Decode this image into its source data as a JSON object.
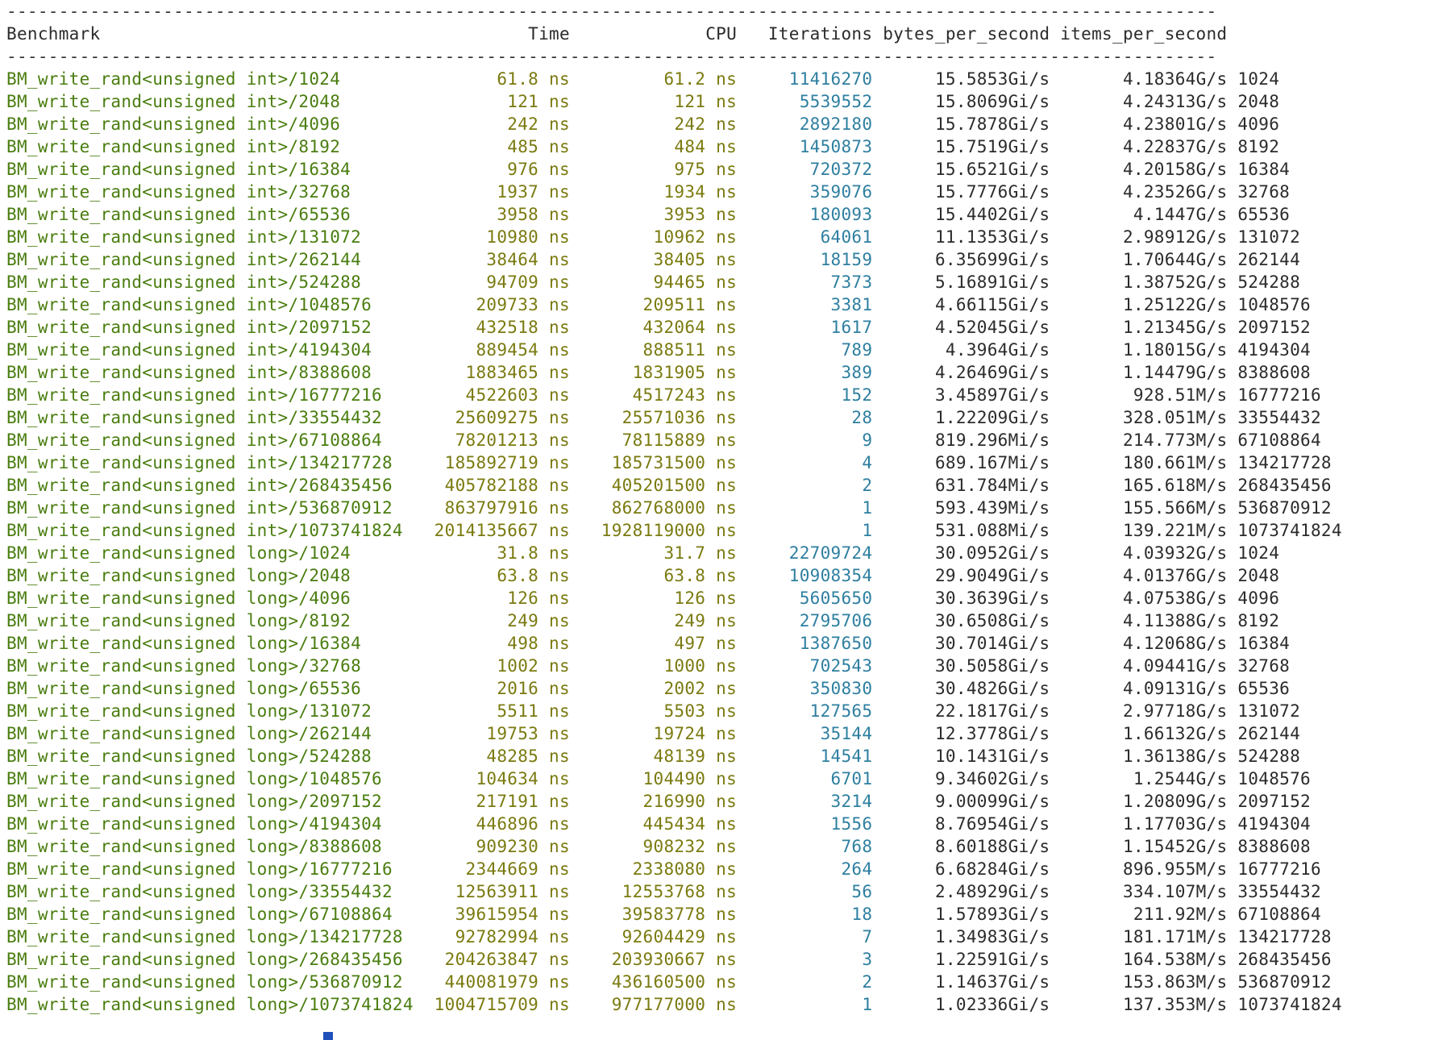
{
  "header": {
    "rule": "--------------------------------------------------------------------------------------------------------------------",
    "columns": [
      "Benchmark",
      "Time",
      "CPU",
      "Iterations",
      "bytes_per_second",
      "items_per_second"
    ]
  },
  "unit": "ns",
  "rows": [
    [
      "BM_write_rand<unsigned int>/1024",
      "61.8",
      "61.2",
      "11416270",
      "15.5853Gi/s",
      "4.18364G/s",
      "1024"
    ],
    [
      "BM_write_rand<unsigned int>/2048",
      "121",
      "121",
      "5539552",
      "15.8069Gi/s",
      "4.24313G/s",
      "2048"
    ],
    [
      "BM_write_rand<unsigned int>/4096",
      "242",
      "242",
      "2892180",
      "15.7878Gi/s",
      "4.23801G/s",
      "4096"
    ],
    [
      "BM_write_rand<unsigned int>/8192",
      "485",
      "484",
      "1450873",
      "15.7519Gi/s",
      "4.22837G/s",
      "8192"
    ],
    [
      "BM_write_rand<unsigned int>/16384",
      "976",
      "975",
      "720372",
      "15.6521Gi/s",
      "4.20158G/s",
      "16384"
    ],
    [
      "BM_write_rand<unsigned int>/32768",
      "1937",
      "1934",
      "359076",
      "15.7776Gi/s",
      "4.23526G/s",
      "32768"
    ],
    [
      "BM_write_rand<unsigned int>/65536",
      "3958",
      "3953",
      "180093",
      "15.4402Gi/s",
      "4.1447G/s",
      "65536"
    ],
    [
      "BM_write_rand<unsigned int>/131072",
      "10980",
      "10962",
      "64061",
      "11.1353Gi/s",
      "2.98912G/s",
      "131072"
    ],
    [
      "BM_write_rand<unsigned int>/262144",
      "38464",
      "38405",
      "18159",
      "6.35699Gi/s",
      "1.70644G/s",
      "262144"
    ],
    [
      "BM_write_rand<unsigned int>/524288",
      "94709",
      "94465",
      "7373",
      "5.16891Gi/s",
      "1.38752G/s",
      "524288"
    ],
    [
      "BM_write_rand<unsigned int>/1048576",
      "209733",
      "209511",
      "3381",
      "4.66115Gi/s",
      "1.25122G/s",
      "1048576"
    ],
    [
      "BM_write_rand<unsigned int>/2097152",
      "432518",
      "432064",
      "1617",
      "4.52045Gi/s",
      "1.21345G/s",
      "2097152"
    ],
    [
      "BM_write_rand<unsigned int>/4194304",
      "889454",
      "888511",
      "789",
      "4.3964Gi/s",
      "1.18015G/s",
      "4194304"
    ],
    [
      "BM_write_rand<unsigned int>/8388608",
      "1883465",
      "1831905",
      "389",
      "4.26469Gi/s",
      "1.14479G/s",
      "8388608"
    ],
    [
      "BM_write_rand<unsigned int>/16777216",
      "4522603",
      "4517243",
      "152",
      "3.45897Gi/s",
      "928.51M/s",
      "16777216"
    ],
    [
      "BM_write_rand<unsigned int>/33554432",
      "25609275",
      "25571036",
      "28",
      "1.22209Gi/s",
      "328.051M/s",
      "33554432"
    ],
    [
      "BM_write_rand<unsigned int>/67108864",
      "78201213",
      "78115889",
      "9",
      "819.296Mi/s",
      "214.773M/s",
      "67108864"
    ],
    [
      "BM_write_rand<unsigned int>/134217728",
      "185892719",
      "185731500",
      "4",
      "689.167Mi/s",
      "180.661M/s",
      "134217728"
    ],
    [
      "BM_write_rand<unsigned int>/268435456",
      "405782188",
      "405201500",
      "2",
      "631.784Mi/s",
      "165.618M/s",
      "268435456"
    ],
    [
      "BM_write_rand<unsigned int>/536870912",
      "863797916",
      "862768000",
      "1",
      "593.439Mi/s",
      "155.566M/s",
      "536870912"
    ],
    [
      "BM_write_rand<unsigned int>/1073741824",
      "2014135667",
      "1928119000",
      "1",
      "531.088Mi/s",
      "139.221M/s",
      "1073741824"
    ],
    [
      "BM_write_rand<unsigned long>/1024",
      "31.8",
      "31.7",
      "22709724",
      "30.0952Gi/s",
      "4.03932G/s",
      "1024"
    ],
    [
      "BM_write_rand<unsigned long>/2048",
      "63.8",
      "63.8",
      "10908354",
      "29.9049Gi/s",
      "4.01376G/s",
      "2048"
    ],
    [
      "BM_write_rand<unsigned long>/4096",
      "126",
      "126",
      "5605650",
      "30.3639Gi/s",
      "4.07538G/s",
      "4096"
    ],
    [
      "BM_write_rand<unsigned long>/8192",
      "249",
      "249",
      "2795706",
      "30.6508Gi/s",
      "4.11388G/s",
      "8192"
    ],
    [
      "BM_write_rand<unsigned long>/16384",
      "498",
      "497",
      "1387650",
      "30.7014Gi/s",
      "4.12068G/s",
      "16384"
    ],
    [
      "BM_write_rand<unsigned long>/32768",
      "1002",
      "1000",
      "702543",
      "30.5058Gi/s",
      "4.09441G/s",
      "32768"
    ],
    [
      "BM_write_rand<unsigned long>/65536",
      "2016",
      "2002",
      "350830",
      "30.4826Gi/s",
      "4.09131G/s",
      "65536"
    ],
    [
      "BM_write_rand<unsigned long>/131072",
      "5511",
      "5503",
      "127565",
      "22.1817Gi/s",
      "2.97718G/s",
      "131072"
    ],
    [
      "BM_write_rand<unsigned long>/262144",
      "19753",
      "19724",
      "35144",
      "12.3778Gi/s",
      "1.66132G/s",
      "262144"
    ],
    [
      "BM_write_rand<unsigned long>/524288",
      "48285",
      "48139",
      "14541",
      "10.1431Gi/s",
      "1.36138G/s",
      "524288"
    ],
    [
      "BM_write_rand<unsigned long>/1048576",
      "104634",
      "104490",
      "6701",
      "9.34602Gi/s",
      "1.2544G/s",
      "1048576"
    ],
    [
      "BM_write_rand<unsigned long>/2097152",
      "217191",
      "216990",
      "3214",
      "9.00099Gi/s",
      "1.20809G/s",
      "2097152"
    ],
    [
      "BM_write_rand<unsigned long>/4194304",
      "446896",
      "445434",
      "1556",
      "8.76954Gi/s",
      "1.17703G/s",
      "4194304"
    ],
    [
      "BM_write_rand<unsigned long>/8388608",
      "909230",
      "908232",
      "768",
      "8.60188Gi/s",
      "1.15452G/s",
      "8388608"
    ],
    [
      "BM_write_rand<unsigned long>/16777216",
      "2344669",
      "2338080",
      "264",
      "6.68284Gi/s",
      "896.955M/s",
      "16777216"
    ],
    [
      "BM_write_rand<unsigned long>/33554432",
      "12563911",
      "12553768",
      "56",
      "2.48929Gi/s",
      "334.107M/s",
      "33554432"
    ],
    [
      "BM_write_rand<unsigned long>/67108864",
      "39615954",
      "39583778",
      "18",
      "1.57893Gi/s",
      "211.92M/s",
      "67108864"
    ],
    [
      "BM_write_rand<unsigned long>/134217728",
      "92782994",
      "92604429",
      "7",
      "1.34983Gi/s",
      "181.171M/s",
      "134217728"
    ],
    [
      "BM_write_rand<unsigned long>/268435456",
      "204263847",
      "203930667",
      "3",
      "1.22591Gi/s",
      "164.538M/s",
      "268435456"
    ],
    [
      "BM_write_rand<unsigned long>/536870912",
      "440081979",
      "436160500",
      "2",
      "1.14637Gi/s",
      "153.863M/s",
      "536870912"
    ],
    [
      "BM_write_rand<unsigned long>/1073741824",
      "1004715709",
      "977177000",
      "1",
      "1.02336Gi/s",
      "137.353M/s",
      "1073741824"
    ]
  ]
}
